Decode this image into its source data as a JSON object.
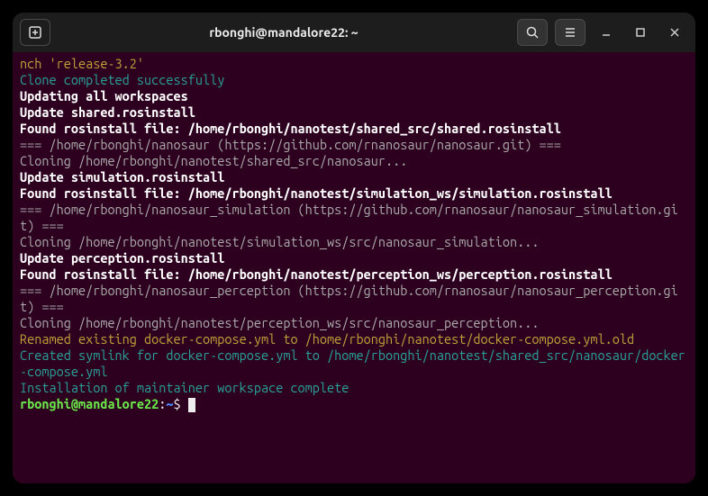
{
  "window": {
    "title": "rbonghi@mandalore22: ~"
  },
  "terminal": {
    "lines": [
      {
        "cls": "c-gold",
        "text": "nch 'release-3.2'"
      },
      {
        "cls": "c-teal",
        "text": "Clone completed successfully"
      },
      {
        "cls": "c-white-bold",
        "text": "Updating all workspaces"
      },
      {
        "cls": "c-white-bold",
        "text": "Update shared.rosinstall"
      },
      {
        "cls": "c-white-bold",
        "text": "Found rosinstall file: /home/rbonghi/nanotest/shared_src/shared.rosinstall"
      },
      {
        "cls": "c-gray",
        "text": "=== /home/rbonghi/nanosaur (https://github.com/rnanosaur/nanosaur.git) ==="
      },
      {
        "cls": "c-gray",
        "text": "Cloning /home/rbonghi/nanotest/shared_src/nanosaur..."
      },
      {
        "cls": "c-white-bold",
        "text": "Update simulation.rosinstall"
      },
      {
        "cls": "c-white-bold",
        "text": "Found rosinstall file: /home/rbonghi/nanotest/simulation_ws/simulation.rosinstall"
      },
      {
        "cls": "c-gray",
        "text": "=== /home/rbonghi/nanosaur_simulation (https://github.com/rnanosaur/nanosaur_simulation.git) ==="
      },
      {
        "cls": "c-gray",
        "text": "Cloning /home/rbonghi/nanotest/simulation_ws/src/nanosaur_simulation..."
      },
      {
        "cls": "c-white-bold",
        "text": "Update perception.rosinstall"
      },
      {
        "cls": "c-white-bold",
        "text": "Found rosinstall file: /home/rbonghi/nanotest/perception_ws/perception.rosinstall"
      },
      {
        "cls": "c-gray",
        "text": "=== /home/rbonghi/nanosaur_perception (https://github.com/rnanosaur/nanosaur_perception.git) ==="
      },
      {
        "cls": "c-gray",
        "text": "Cloning /home/rbonghi/nanotest/perception_ws/src/nanosaur_perception..."
      },
      {
        "cls": "c-gold",
        "text": "Renamed existing docker-compose.yml to /home/rbonghi/nanotest/docker-compose.yml.old"
      },
      {
        "cls": "c-teal",
        "text": "Created symlink for docker-compose.yml to /home/rbonghi/nanotest/shared_src/nanosaur/docker-compose.yml"
      },
      {
        "cls": "c-teal",
        "text": "Installation of maintainer workspace complete"
      }
    ],
    "prompt": {
      "user_host": "rbonghi@mandalore22",
      "sep": ":",
      "path": "~",
      "symbol": "$"
    }
  }
}
